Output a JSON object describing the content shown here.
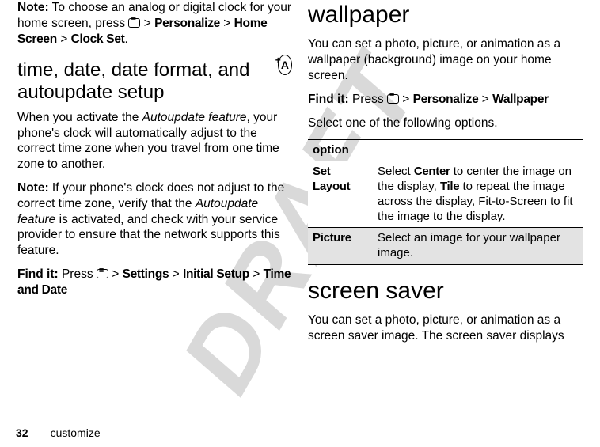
{
  "watermark": "DRAFT",
  "left": {
    "note1_label": "Note:",
    "note1_body_a": " To choose an analog or digital clock for your home screen, press ",
    "note1_body_b": " > ",
    "note1_personalize": "Personalize",
    "note1_body_c": " > ",
    "note1_home": "Home Screen",
    "note1_body_d": " > ",
    "note1_clock": "Clock Set",
    "note1_end": ".",
    "heading": "time, date, date format, and autoupdate setup",
    "icon_letter": "A",
    "para1_a": "When you activate the ",
    "para1_feat": "Autoupdate feature",
    "para1_b": ", your phone's clock will automatically adjust to the correct time zone when you travel from one time zone to another.",
    "note2_label": "Note:",
    "note2_a": " If your phone's clock does not adjust to the correct time zone, verify that the ",
    "note2_feat": "Autoupdate feature",
    "note2_b": " is activated, and check with your service provider to ensure that the network supports this feature.",
    "findit_label": "Find it:",
    "findit_a": " Press ",
    "findit_settings": "Settings",
    "findit_initial": "Initial Setup",
    "findit_time": "Time and Date"
  },
  "right": {
    "heading1": "wallpaper",
    "para1": "You can set a photo, picture, or animation as a wallpaper (background) image on your home screen.",
    "findit_label": "Find it:",
    "findit_a": " Press ",
    "findit_personalize": "Personalize",
    "findit_wallpaper": "Wallpaper",
    "select_line": "Select one of the following options.",
    "table": {
      "header": "option",
      "row1_label": "Set Layout",
      "row1_a": "Select ",
      "row1_center": "Center",
      "row1_b": " to center the image on the display, ",
      "row1_tile": "Tile",
      "row1_c": " to repeat the image across the display, Fit-to-Screen to fit the image to the display.",
      "row2_label": "Picture",
      "row2_body": "Select an image for your wallpaper image."
    },
    "heading2": "screen saver",
    "para2": "You can set a photo, picture, or animation as a screen saver image. The screen saver displays"
  },
  "footer": {
    "page": "32",
    "section": "customize"
  }
}
